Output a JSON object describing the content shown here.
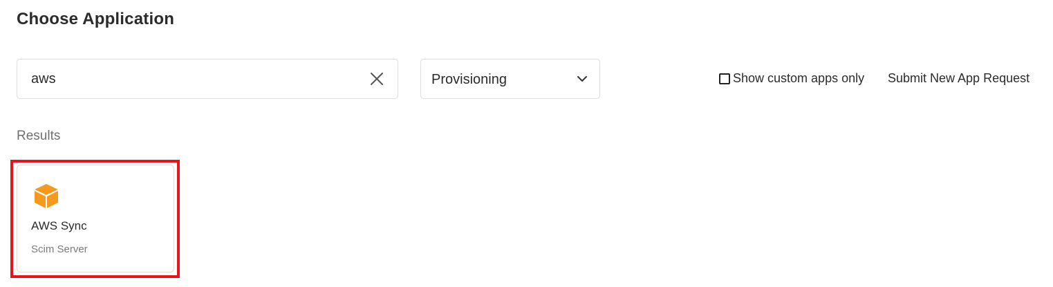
{
  "header": {
    "title": "Choose Application"
  },
  "search": {
    "value": "aws",
    "clear_icon": "close-icon"
  },
  "filter": {
    "selected": "Provisioning",
    "icon": "chevron-down-icon"
  },
  "options": {
    "custom_apps_label": "Show custom apps only",
    "custom_apps_checked": false,
    "submit_request_label": "Submit New App Request"
  },
  "results": {
    "label": "Results",
    "items": [
      {
        "name": "AWS Sync",
        "type": "Scim Server",
        "icon": "aws-cube-icon",
        "icon_color": "#f7991c",
        "highlighted": true
      }
    ]
  },
  "colors": {
    "highlight": "#e8141b",
    "border": "#dcdcdc",
    "muted_text": "#6f6f6f"
  }
}
